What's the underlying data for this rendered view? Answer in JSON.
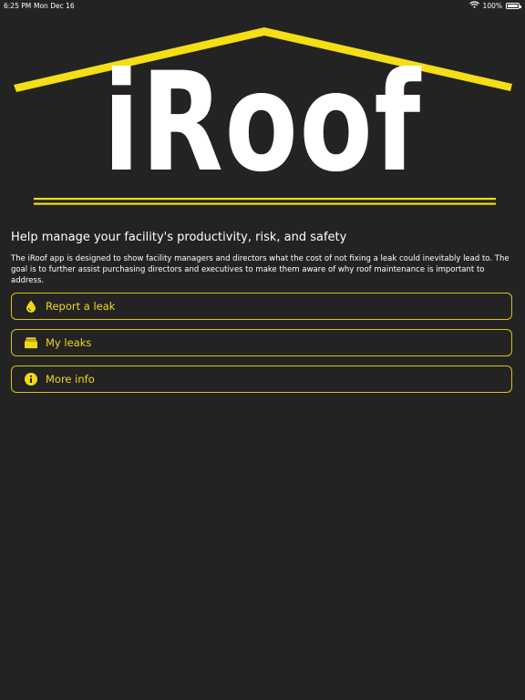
{
  "status_bar": {
    "time": "6:25 PM",
    "date": "Mon Dec 16",
    "battery": "100%",
    "icons": [
      "wifi-icon",
      "battery-icon"
    ]
  },
  "logo": {
    "text": "iRoof"
  },
  "tagline": "Help manage your facility's productivity, risk, and safety",
  "description": "The iRoof app is designed to show facility managers and directors what the cost of not fixing a leak could inevitably lead to. The goal is to further assist purchasing directors and executives to make them aware of why roof maintenance is important to address.",
  "buttons": [
    {
      "label": "Report a leak",
      "icon": "water-drop-icon"
    },
    {
      "label": "My leaks",
      "icon": "folder-icon"
    },
    {
      "label": "More info",
      "icon": "info-icon"
    }
  ],
  "colors": {
    "background": "#232323",
    "accent": "#f2d81a",
    "border": "#d9c21a"
  }
}
